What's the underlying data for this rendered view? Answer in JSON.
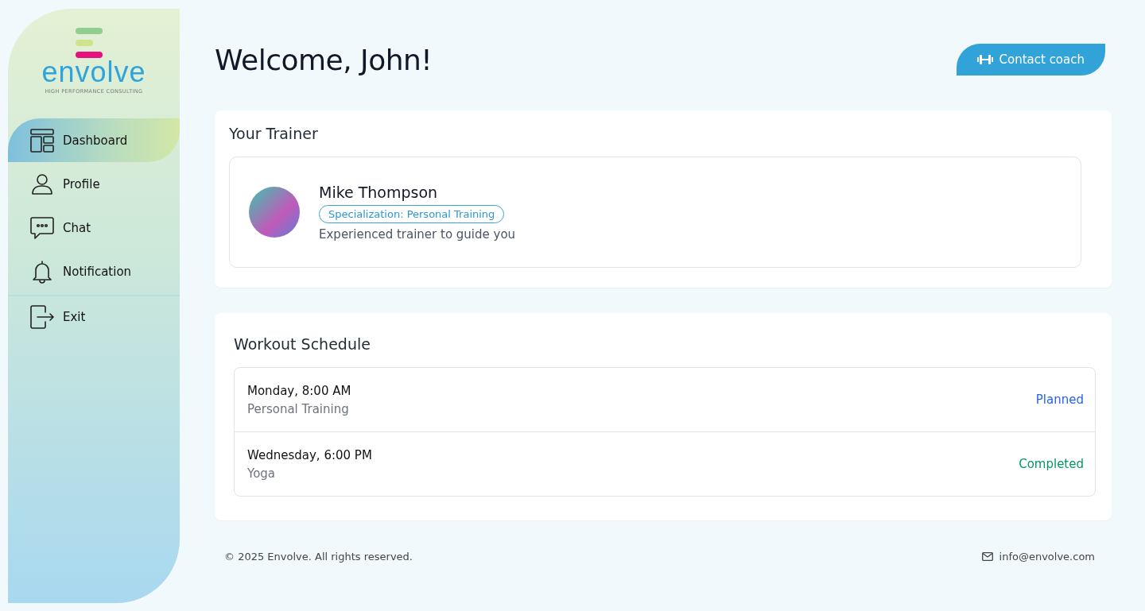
{
  "logo": {
    "name": "envolve",
    "tagline": "HIGH PERFORMANCE CONSULTING"
  },
  "nav": [
    {
      "kind": "dashboard",
      "label": "Dashboard",
      "selected": true
    },
    {
      "kind": "profile",
      "label": "Profile",
      "selected": false
    },
    {
      "kind": "chat",
      "label": "Chat",
      "selected": false
    },
    {
      "kind": "bell",
      "label": "Notification",
      "selected": false
    }
  ],
  "exit": {
    "label": "Exit"
  },
  "header": {
    "title": "Welcome, John!",
    "button": "Contact coach"
  },
  "trainer_card": {
    "title": "Your Trainer",
    "name": "Mike Thompson",
    "tag": "Specialization: Personal Training",
    "description": "Experienced trainer to guide you"
  },
  "schedule": {
    "title": "Workout Schedule",
    "rows": [
      {
        "when": "Monday, 8:00 AM",
        "activity": "Personal Training",
        "status": "Planned",
        "kind": "planned"
      },
      {
        "when": "Wednesday, 6:00 PM",
        "activity": "Yoga",
        "status": "Completed",
        "kind": "completed"
      }
    ]
  },
  "footer": {
    "copyright": "© 2025 Envolve. All rights reserved.",
    "email": "info@envolve.com"
  }
}
